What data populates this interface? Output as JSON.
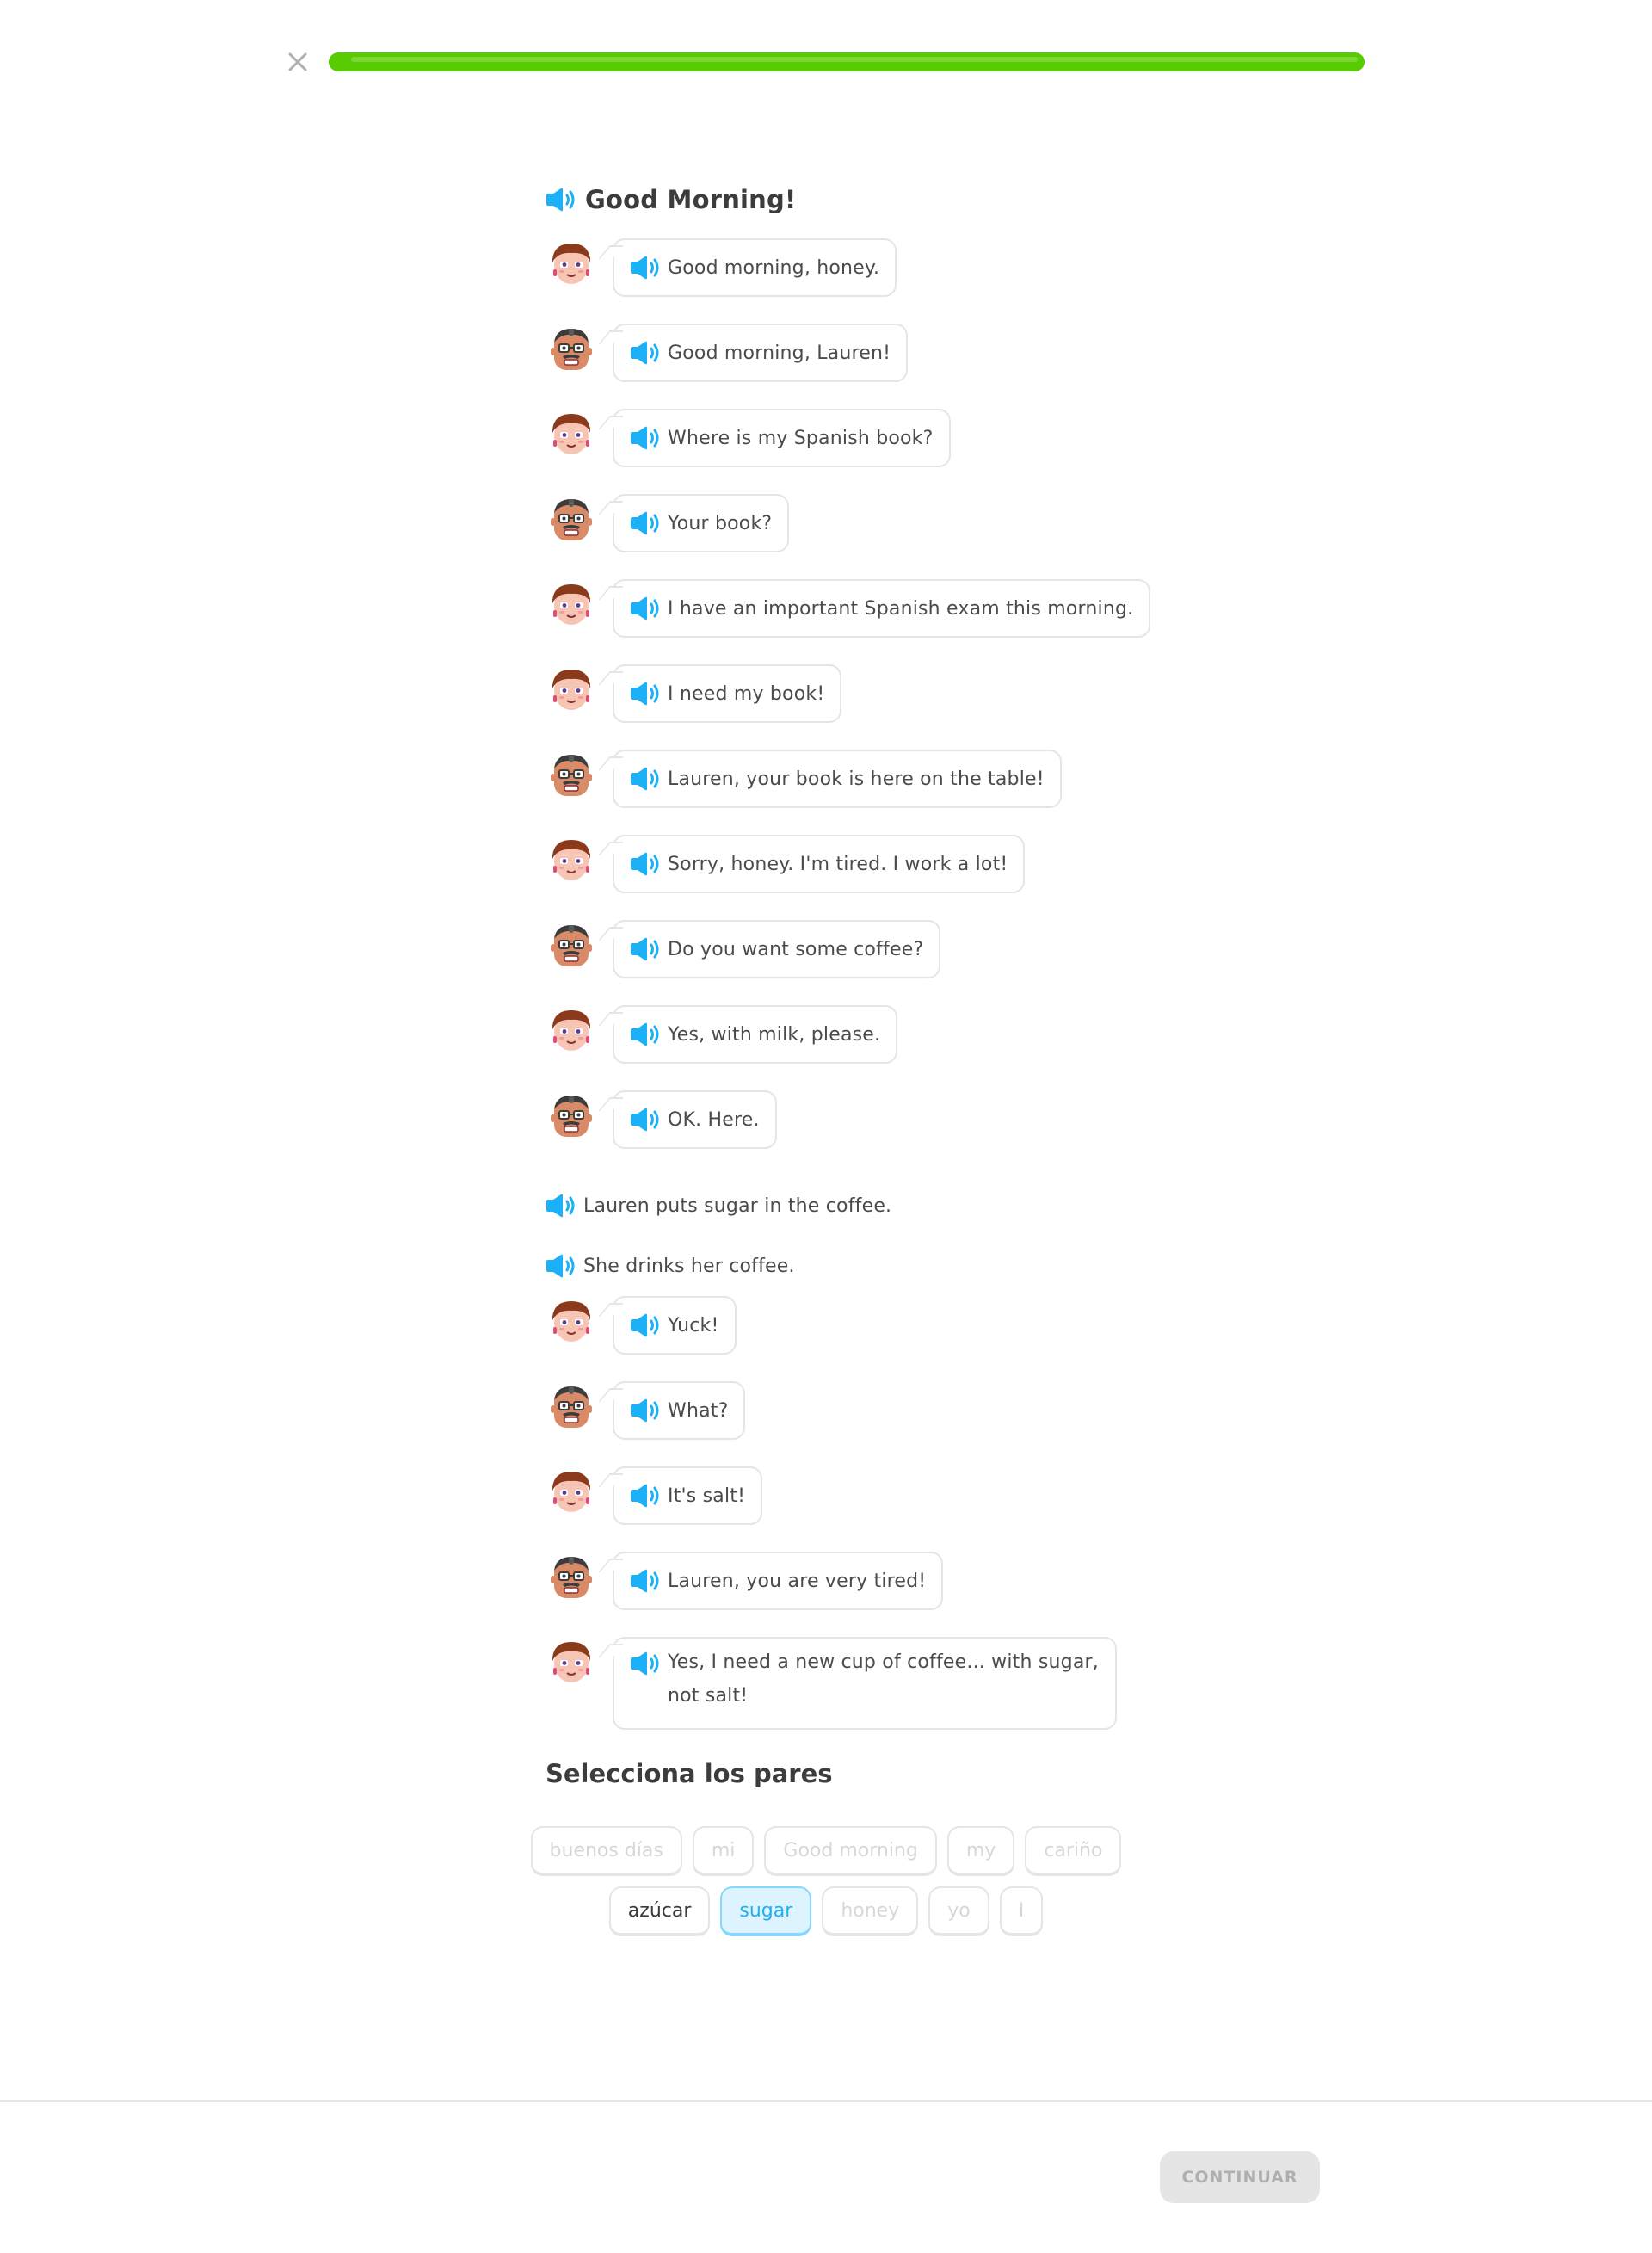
{
  "header": {
    "progress_fraction": 1.0
  },
  "colors": {
    "accent_blue": "#1cb0f6",
    "progress_green": "#58cc02",
    "border": "#e5e5e5"
  },
  "story": {
    "title": "Good Morning!",
    "lines": [
      {
        "type": "dialogue",
        "speaker": "lauren",
        "text": "Good morning, honey."
      },
      {
        "type": "dialogue",
        "speaker": "man",
        "text": "Good morning, Lauren!"
      },
      {
        "type": "dialogue",
        "speaker": "lauren",
        "text": "Where is my Spanish book?"
      },
      {
        "type": "dialogue",
        "speaker": "man",
        "text": "Your book?"
      },
      {
        "type": "dialogue",
        "speaker": "lauren",
        "text": "I have an important Spanish exam this morning."
      },
      {
        "type": "dialogue",
        "speaker": "lauren",
        "text": "I need my book!"
      },
      {
        "type": "dialogue",
        "speaker": "man",
        "text": "Lauren, your book is here on the table!"
      },
      {
        "type": "dialogue",
        "speaker": "lauren",
        "text": "Sorry, honey. I'm tired. I work a lot!"
      },
      {
        "type": "dialogue",
        "speaker": "man",
        "text": "Do you want some coffee?"
      },
      {
        "type": "dialogue",
        "speaker": "lauren",
        "text": "Yes, with milk, please."
      },
      {
        "type": "dialogue",
        "speaker": "man",
        "text": "OK. Here."
      },
      {
        "type": "narration",
        "text": "Lauren puts sugar in the coffee."
      },
      {
        "type": "narration",
        "text": "She drinks her coffee."
      },
      {
        "type": "dialogue",
        "speaker": "lauren",
        "text": "Yuck!"
      },
      {
        "type": "dialogue",
        "speaker": "man",
        "text": "What?"
      },
      {
        "type": "dialogue",
        "speaker": "lauren",
        "text": "It's salt!"
      },
      {
        "type": "dialogue",
        "speaker": "man",
        "text": "Lauren, you are very tired!"
      },
      {
        "type": "dialogue",
        "speaker": "lauren",
        "text": "Yes, I need a new cup of coffee... with sugar, not salt!"
      }
    ]
  },
  "pairs": {
    "title": "Selecciona los pares",
    "row1": [
      {
        "label": "buenos días",
        "state": "matched"
      },
      {
        "label": "mi",
        "state": "matched"
      },
      {
        "label": "Good morning",
        "state": "matched"
      },
      {
        "label": "my",
        "state": "matched"
      },
      {
        "label": "cariño",
        "state": "matched"
      }
    ],
    "row2": [
      {
        "label": "azúcar",
        "state": "active"
      },
      {
        "label": "sugar",
        "state": "selected"
      },
      {
        "label": "honey",
        "state": "matched"
      },
      {
        "label": "yo",
        "state": "matched"
      },
      {
        "label": "I",
        "state": "matched"
      }
    ]
  },
  "footer": {
    "continue_label": "CONTINUAR"
  }
}
